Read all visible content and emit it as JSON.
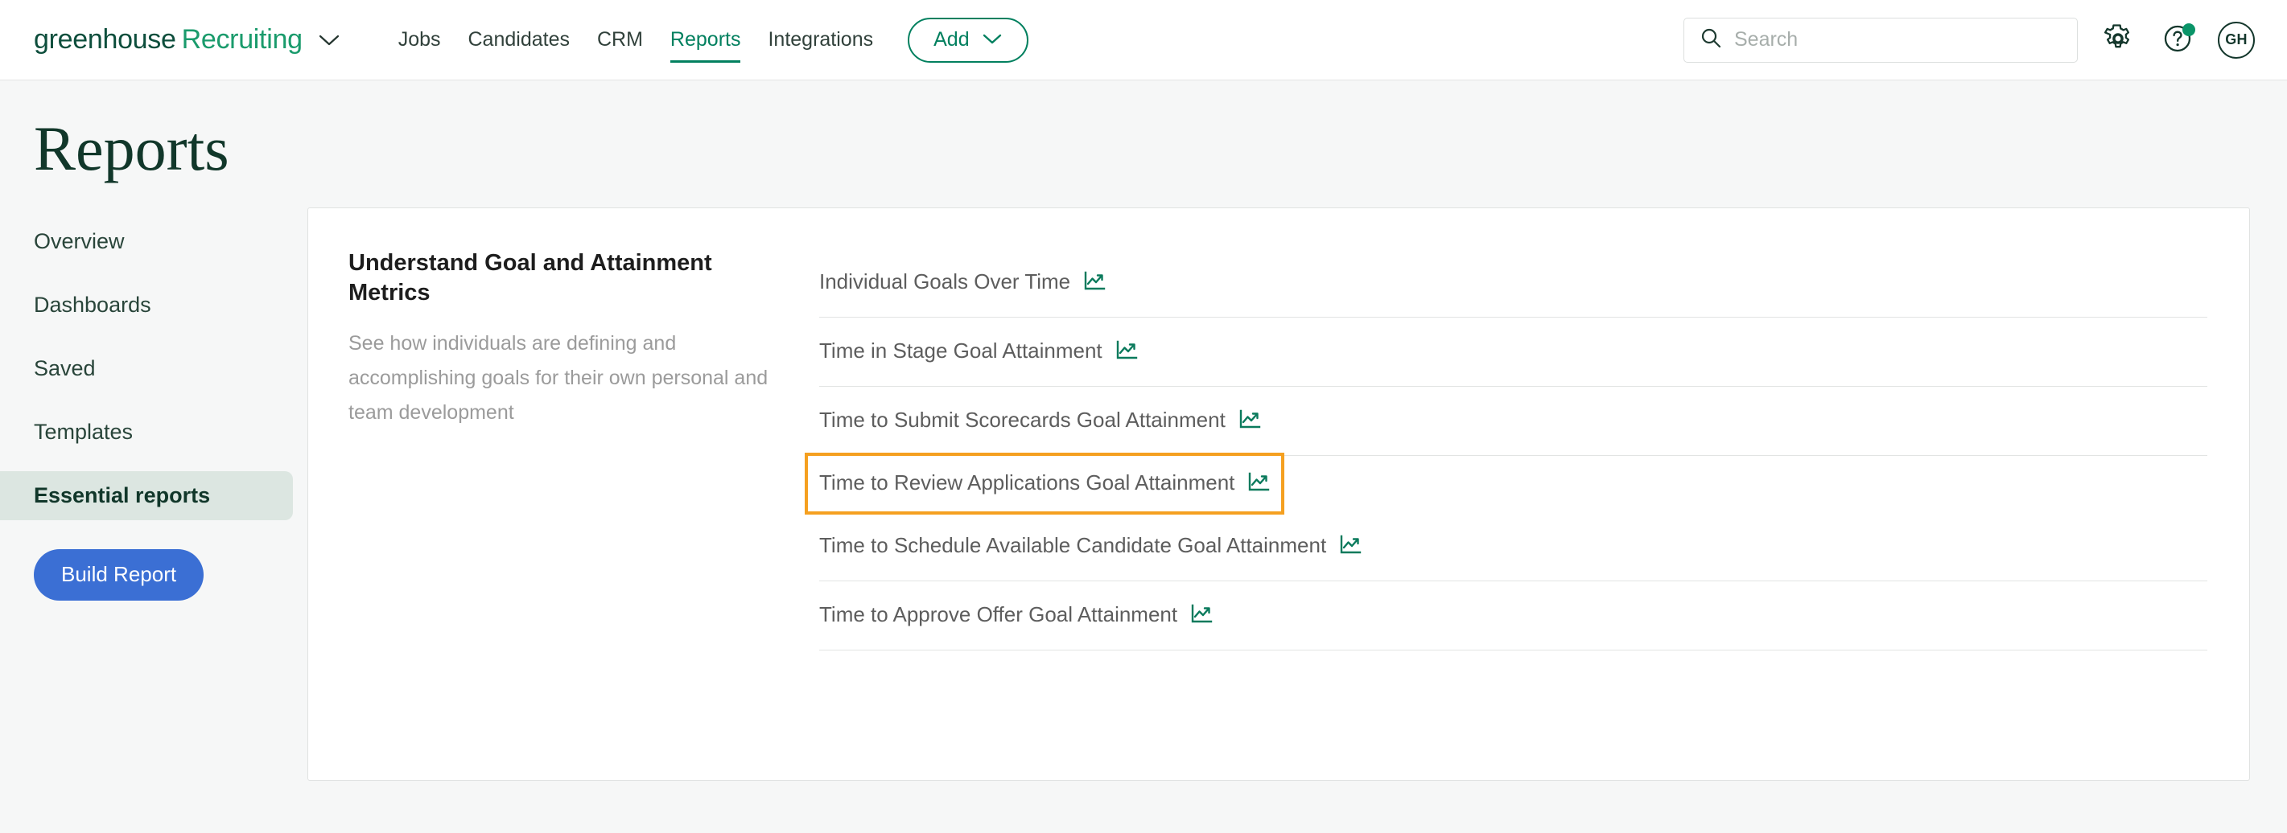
{
  "brand": {
    "name": "greenhouse",
    "product": "Recruiting",
    "caret_icon": "chevron-down-icon"
  },
  "nav": {
    "links": [
      {
        "label": "Jobs",
        "active": false
      },
      {
        "label": "Candidates",
        "active": false
      },
      {
        "label": "CRM",
        "active": false
      },
      {
        "label": "Reports",
        "active": true
      },
      {
        "label": "Integrations",
        "active": false
      }
    ],
    "add_button": {
      "label": "Add",
      "icon": "chevron-down-icon"
    },
    "search": {
      "placeholder": "Search",
      "value": "",
      "icon": "search-icon"
    },
    "settings_icon": "gear-icon",
    "help_icon": "question-mark-icon",
    "help_has_notification": true,
    "avatar_initials": "GH"
  },
  "page": {
    "title": "Reports"
  },
  "sidebar": {
    "items": [
      {
        "label": "Overview",
        "active": false
      },
      {
        "label": "Dashboards",
        "active": false
      },
      {
        "label": "Saved",
        "active": false
      },
      {
        "label": "Templates",
        "active": false
      },
      {
        "label": "Essential reports",
        "active": true
      }
    ],
    "build_button_label": "Build Report"
  },
  "main": {
    "heading": "Understand Goal and Attainment Metrics",
    "subheading": "See how individuals are defining and accomplishing goals for their own personal and team development",
    "reports": [
      {
        "label": "Individual Goals Over Time",
        "icon": "line-chart-icon",
        "highlighted": false
      },
      {
        "label": "Time in Stage Goal Attainment",
        "icon": "line-chart-icon",
        "highlighted": false
      },
      {
        "label": "Time to Submit Scorecards Goal Attainment",
        "icon": "line-chart-icon",
        "highlighted": false
      },
      {
        "label": "Time to Review Applications Goal Attainment",
        "icon": "line-chart-icon",
        "highlighted": true
      },
      {
        "label": "Time to Schedule Available Candidate Goal Attainment",
        "icon": "line-chart-icon",
        "highlighted": false
      },
      {
        "label": "Time to Approve Offer Goal Attainment",
        "icon": "line-chart-icon",
        "highlighted": false
      }
    ]
  },
  "colors": {
    "brand_green": "#1a9b6c",
    "brand_dark_green": "#0d4e3c",
    "accent_green": "#02805f",
    "build_button_blue": "#3b6fd4",
    "highlight_orange": "#f5a020",
    "sidebar_active_bg": "#dce6e1",
    "page_bg": "#f6f7f7"
  }
}
